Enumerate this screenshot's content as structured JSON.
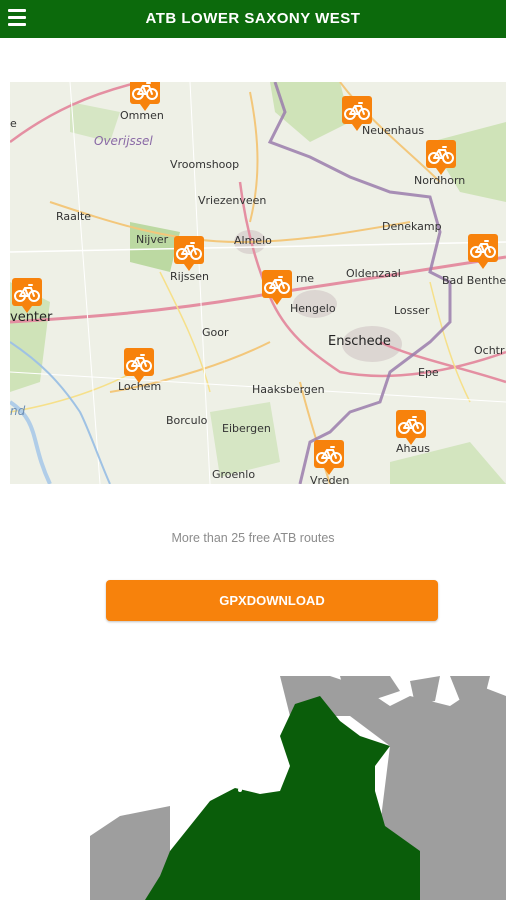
{
  "header": {
    "title": "ATB LOWER SAXONY WEST",
    "menu_icon": "hamburger-menu-icon"
  },
  "route_map": {
    "marker_icon": "bicycle-icon",
    "marker_color": "#f7820c",
    "region_label": "Overijssel",
    "places": {
      "ommen": "Ommen",
      "neuenhaus": "Neuenhaus",
      "nordhorn": "Nordhorn",
      "vroomshoop": "Vroomshoop",
      "vriezenveen": "Vriezenveen",
      "raalte": "Raalte",
      "nijverdal": "Nijver",
      "almelo": "Almelo",
      "denekamp": "Denekamp",
      "rijssen": "Rijssen",
      "borne": "rne",
      "oldenzaal": "Oldenzaal",
      "bad_bentheim": "Bad Benthe",
      "hengelo": "Hengelo",
      "losser": "Losser",
      "deventer": "venter",
      "goor": "Goor",
      "enschede": "Enschede",
      "ochtrup": "Ochtr",
      "epe": "Epe",
      "lochem": "Lochem",
      "haaksbergen": "Haaksbergen",
      "borculo": "Borculo",
      "eibergen": "Eibergen",
      "ahaus": "Ahaus",
      "groenlo": "Groenlo",
      "vreden": "Vreden",
      "nd": "nd",
      "e": "e"
    }
  },
  "tagline": "More than 25 free ATB routes",
  "gpx_button": {
    "label": "GPXDOWNLOAD",
    "color": "#f7820c"
  },
  "colors": {
    "header_bg": "#0c6a0c",
    "region_green": "#0a5d0a",
    "land_grey": "#9e9e9e"
  }
}
